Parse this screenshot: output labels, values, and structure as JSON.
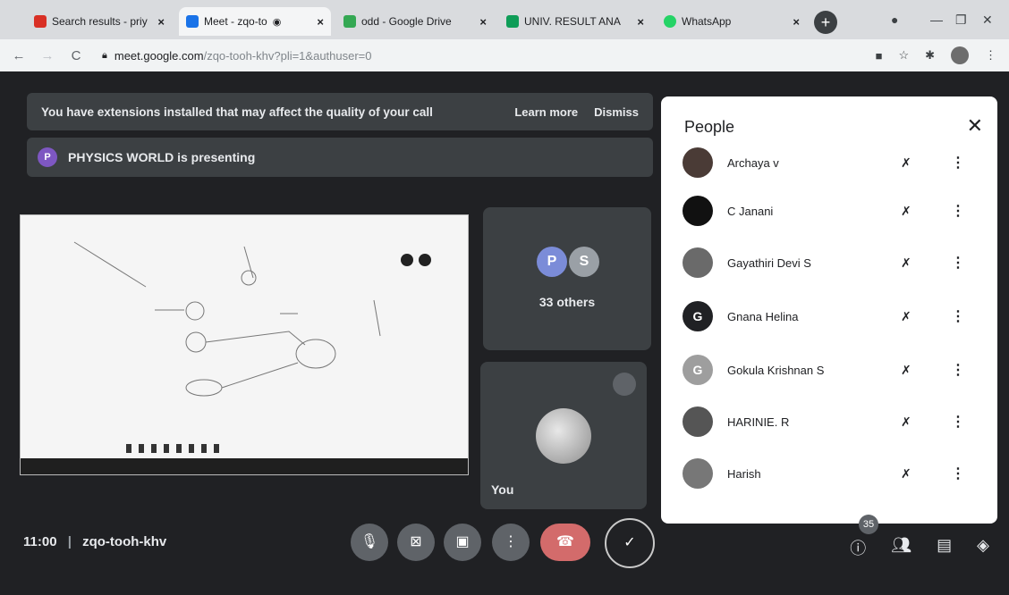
{
  "browser": {
    "tabs": [
      {
        "label": "Search results - priy",
        "active": false
      },
      {
        "label": "Meet - zqo-to",
        "active": true
      },
      {
        "label": "odd - Google Drive",
        "active": false
      },
      {
        "label": "UNIV. RESULT ANA",
        "active": false
      },
      {
        "label": "WhatsApp",
        "active": false
      }
    ],
    "url_host": "meet.google.com",
    "url_path": "/zqo-tooh-khv?pli=1&authuser=0"
  },
  "banner": {
    "message": "You have extensions installed that may affect the quality of your call",
    "learn_more": "Learn more",
    "dismiss": "Dismiss"
  },
  "presenting": {
    "initial": "P",
    "text": "PHYSICS WORLD is presenting"
  },
  "tiles": {
    "others_initials": [
      "P",
      "S"
    ],
    "others_label": "33 others",
    "you_label": "You"
  },
  "people": {
    "title": "People",
    "list": [
      {
        "name": "Archaya v",
        "initial": ""
      },
      {
        "name": "C Janani",
        "initial": ""
      },
      {
        "name": "Gayathiri Devi S",
        "initial": ""
      },
      {
        "name": "Gnana Helina",
        "initial": "G"
      },
      {
        "name": "Gokula Krishnan S",
        "initial": "G"
      },
      {
        "name": "HARINIE. R",
        "initial": ""
      },
      {
        "name": "Harish",
        "initial": ""
      }
    ]
  },
  "bottom": {
    "time": "11:00",
    "meeting_code": "zqo-tooh-khv",
    "participants_count": "35"
  }
}
